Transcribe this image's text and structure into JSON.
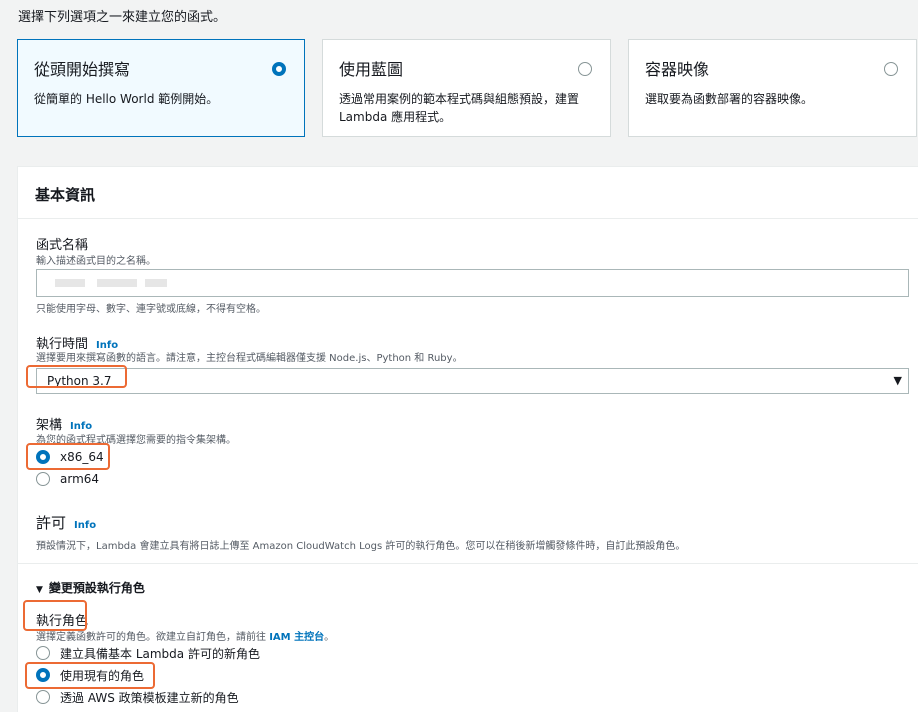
{
  "intro": "選擇下列選項之一來建立您的函式。",
  "options": [
    {
      "title": "從頭開始撰寫",
      "desc": "從簡單的 Hello World 範例開始。",
      "selected": true
    },
    {
      "title": "使用藍圖",
      "desc": "透過常用案例的範本程式碼與組態預設，建置 Lambda 應用程式。",
      "selected": false
    },
    {
      "title": "容器映像",
      "desc": "選取要為函數部署的容器映像。",
      "selected": false
    }
  ],
  "basic": {
    "header": "基本資訊",
    "function_name": {
      "label": "函式名稱",
      "hint": "輸入描述函式目的之名稱。",
      "constraint": "只能使用字母、數字、連字號或底線，不得有空格。"
    },
    "runtime": {
      "label": "執行時間",
      "info": "Info",
      "hint": "選擇要用來撰寫函數的語言。請注意，主控台程式碼編輯器僅支援 Node.js、Python 和 Ruby。",
      "value": "Python 3.7"
    },
    "architecture": {
      "label": "架構",
      "info": "Info",
      "hint": "為您的函式程式碼選擇您需要的指令集架構。",
      "options": [
        "x86_64",
        "arm64"
      ],
      "selected": "x86_64"
    },
    "permissions": {
      "title": "許可",
      "info": "Info",
      "desc": "預設情況下，Lambda 會建立具有將日誌上傳至 Amazon CloudWatch Logs 許可的執行角色。您可以在稍後新增觸發條件時，自訂此預設角色。"
    },
    "change_role": {
      "toggle": "變更預設執行角色",
      "role_label": "執行角色",
      "role_hint_prefix": "選擇定義函數許可的角色。欲建立自訂角色，請前往",
      "role_hint_link": "IAM 主控台",
      "role_hint_suffix": "。",
      "options": [
        "建立具備基本 Lambda 許可的新角色",
        "使用現有的角色",
        "透過 AWS 政策模板建立新的角色"
      ],
      "selected_index": 1
    }
  },
  "colors": {
    "accent": "#0073bb",
    "highlight": "#ec6a34"
  }
}
